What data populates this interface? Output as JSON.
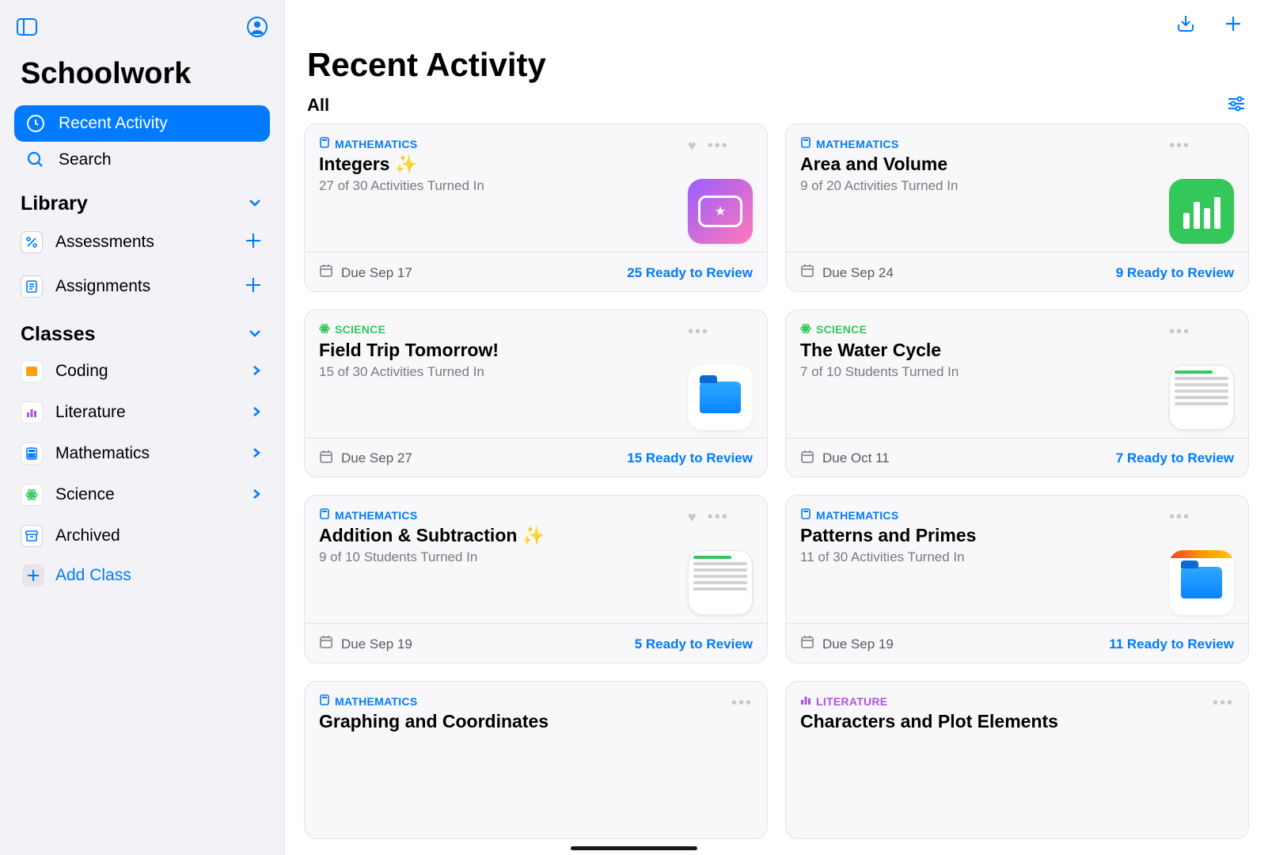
{
  "app": {
    "title": "Schoolwork"
  },
  "nav": {
    "recent": "Recent Activity",
    "search": "Search"
  },
  "library": {
    "header": "Library",
    "assessments": "Assessments",
    "assignments": "Assignments"
  },
  "classesSection": {
    "header": "Classes",
    "archived": "Archived",
    "addClass": "Add Class",
    "items": [
      {
        "label": "Coding",
        "color": "#ff9f0a",
        "glyph": "code"
      },
      {
        "label": "Literature",
        "color": "#af52de",
        "glyph": "bars"
      },
      {
        "label": "Mathematics",
        "color": "#007aff",
        "glyph": "calc"
      },
      {
        "label": "Science",
        "color": "#34c759",
        "glyph": "atom"
      }
    ]
  },
  "main": {
    "title": "Recent Activity",
    "filterLabel": "All"
  },
  "cards": [
    {
      "subjectClass": "math",
      "subject": "MATHEMATICS",
      "title": "Integers ✨",
      "sub": "27 of 30 Activities Turned In",
      "due": "Due Sep 17",
      "ready": "25 Ready to Review",
      "heart": true,
      "thumb": "gradient"
    },
    {
      "subjectClass": "math",
      "subject": "MATHEMATICS",
      "title": "Area and Volume",
      "sub": "9 of 20 Activities Turned In",
      "due": "Due Sep 24",
      "ready": "9 Ready to Review",
      "heart": false,
      "thumb": "green"
    },
    {
      "subjectClass": "science",
      "subject": "SCIENCE",
      "title": "Field Trip Tomorrow!",
      "sub": "15 of 30 Activities Turned In",
      "due": "Due Sep 27",
      "ready": "15 Ready to Review",
      "heart": false,
      "thumb": "folder"
    },
    {
      "subjectClass": "science",
      "subject": "SCIENCE",
      "title": "The Water Cycle",
      "sub": "7 of 10 Students Turned In",
      "due": "Due Oct 11",
      "ready": "7 Ready to Review",
      "heart": false,
      "thumb": "doc"
    },
    {
      "subjectClass": "math",
      "subject": "MATHEMATICS",
      "title": "Addition & Subtraction ✨",
      "sub": "9 of 10 Students Turned In",
      "due": "Due Sep 19",
      "ready": "5 Ready to Review",
      "heart": true,
      "thumb": "doc"
    },
    {
      "subjectClass": "math",
      "subject": "MATHEMATICS",
      "title": "Patterns and Primes",
      "sub": "11 of 30 Activities Turned In",
      "due": "Due Sep 19",
      "ready": "11 Ready to Review",
      "heart": false,
      "thumb": "yellowfolder"
    },
    {
      "subjectClass": "math",
      "subject": "MATHEMATICS",
      "title": "Graphing and Coordinates",
      "sub": "",
      "due": "",
      "ready": "",
      "heart": false,
      "thumb": "none"
    },
    {
      "subjectClass": "literature",
      "subject": "LITERATURE",
      "title": "Characters and Plot Elements",
      "sub": "",
      "due": "",
      "ready": "",
      "heart": false,
      "thumb": "none"
    }
  ]
}
